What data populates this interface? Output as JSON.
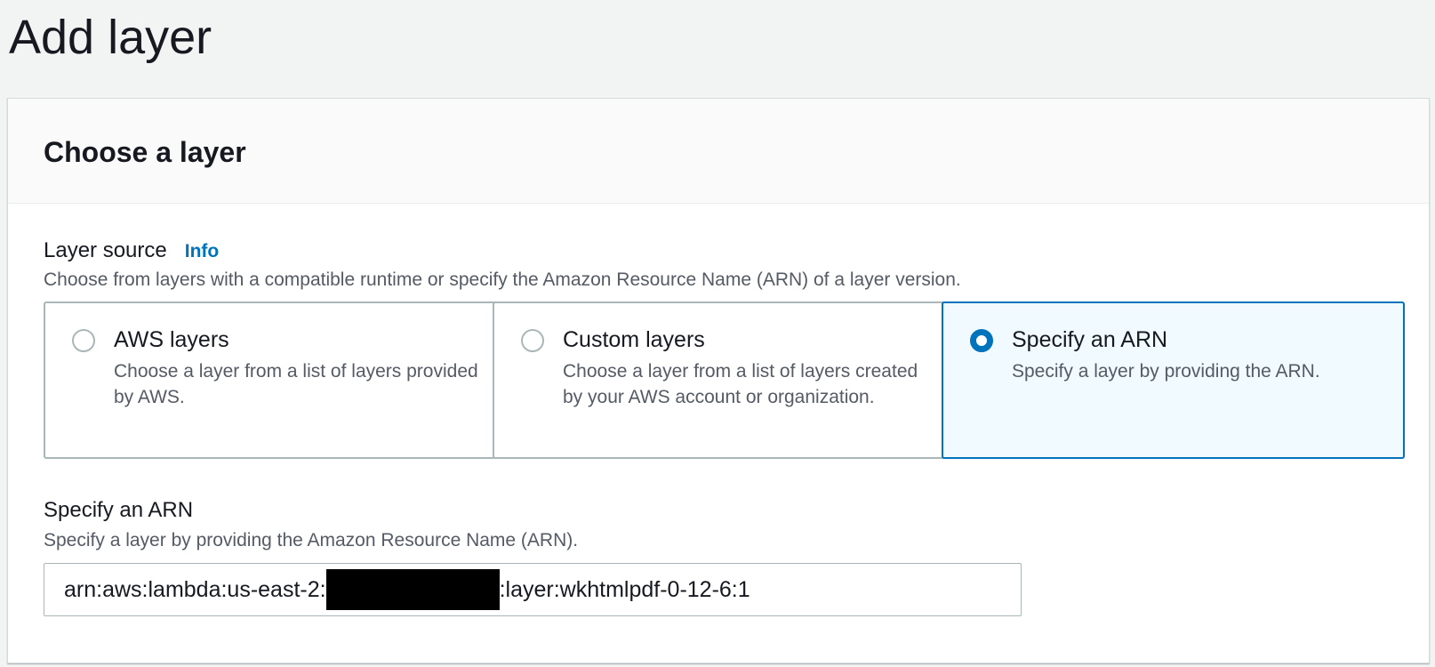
{
  "page": {
    "title": "Add layer"
  },
  "card": {
    "title": "Choose a layer"
  },
  "layer_source": {
    "label": "Layer source",
    "info_link": "Info",
    "description": "Choose from layers with a compatible runtime or specify the Amazon Resource Name (ARN) of a layer version.",
    "options": [
      {
        "title": "AWS layers",
        "description": "Choose a layer from a list of layers provided by AWS.",
        "selected": false
      },
      {
        "title": "Custom layers",
        "description": "Choose a layer from a list of layers created by your AWS account or organization.",
        "selected": false
      },
      {
        "title": "Specify an ARN",
        "description": "Specify a layer by providing the ARN.",
        "selected": true
      }
    ]
  },
  "arn_field": {
    "label": "Specify an ARN",
    "description": "Specify a layer by providing the Amazon Resource Name (ARN).",
    "value_prefix": "arn:aws:lambda:us-east-2:",
    "value_suffix": ":layer:wkhtmlpdf-0-12-6:1"
  },
  "colors": {
    "accent": "#0073bb",
    "selected_tile_bg": "#f1faff",
    "page_bg": "#f2f3f3"
  }
}
